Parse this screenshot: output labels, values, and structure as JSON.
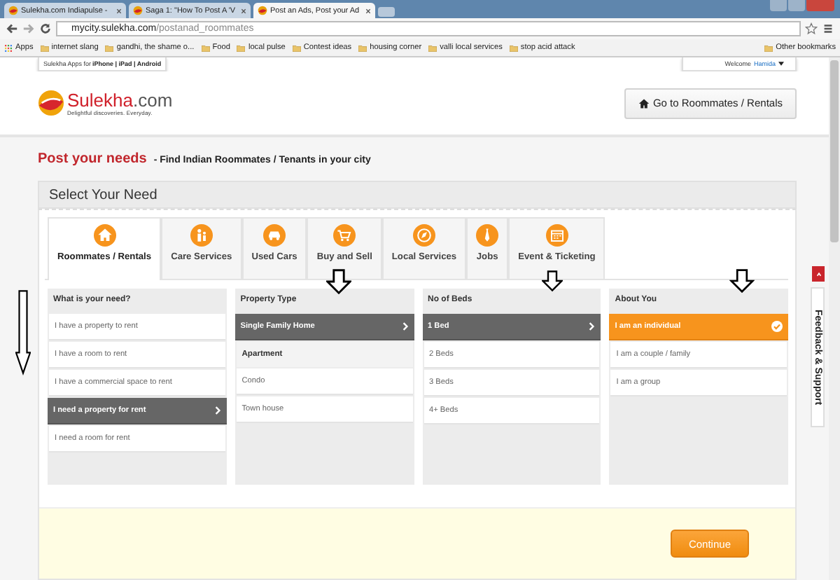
{
  "browser": {
    "tabs": [
      {
        "title": "Sulekha.com Indiapulse -",
        "selected": false
      },
      {
        "title": "Saga 1: \"How To Post A 'V",
        "selected": false
      },
      {
        "title": "Post an Ads, Post your Ad",
        "selected": true
      }
    ],
    "address": {
      "host": "mycity.sulekha.com",
      "path": "/postanad_roommates"
    },
    "bookmarks": [
      "Apps",
      "internet slang",
      "gandhi, the shame o...",
      "Food",
      "local pulse",
      "Contest ideas",
      "housing corner",
      "valli local services",
      "stop acid attack"
    ],
    "other_bookmarks": "Other bookmarks"
  },
  "top_bar": {
    "apps_prefix": "Sulekha Apps for",
    "apps_links": "iPhone | iPad | Android",
    "welcome": "Welcome",
    "user": "Hamida"
  },
  "logo": {
    "name": "Sulekha",
    "suffix": ".com",
    "tagline": "Delightful discoveries. Everyday."
  },
  "header_button": "Go to Roommates / Rentals",
  "heading": {
    "title": "Post your needs",
    "subtitle": "- Find Indian Roommates / Tenants in your city"
  },
  "section_title": "Select Your Need",
  "categories": [
    {
      "label": "Roommates / Rentals",
      "selected": true
    },
    {
      "label": "Care Services",
      "selected": false
    },
    {
      "label": "Used Cars",
      "selected": false
    },
    {
      "label": "Buy and Sell",
      "selected": false
    },
    {
      "label": "Local Services",
      "selected": false
    },
    {
      "label": "Jobs",
      "selected": false
    },
    {
      "label": "Event & Ticketing",
      "selected": false
    }
  ],
  "columns": [
    {
      "title": "What is your need?",
      "items": [
        {
          "kind": "option",
          "label": "I have a property to rent",
          "selected": false
        },
        {
          "kind": "option",
          "label": "I have a room to rent",
          "selected": false
        },
        {
          "kind": "option",
          "label": "I have a commercial space to rent",
          "selected": false
        },
        {
          "kind": "option",
          "label": "I need a property for rent",
          "selected": true
        },
        {
          "kind": "option",
          "label": "I need a room for rent",
          "selected": false
        }
      ]
    },
    {
      "title": "Property Type",
      "items": [
        {
          "kind": "option",
          "label": "Single Family Home",
          "selected": true
        },
        {
          "kind": "group",
          "label": "Apartment"
        },
        {
          "kind": "option",
          "label": "Condo",
          "selected": false
        },
        {
          "kind": "option",
          "label": "Town house",
          "selected": false
        }
      ]
    },
    {
      "title": "No of Beds",
      "items": [
        {
          "kind": "option",
          "label": "1 Bed",
          "selected": true
        },
        {
          "kind": "option",
          "label": "2 Beds",
          "selected": false
        },
        {
          "kind": "option",
          "label": "3 Beds",
          "selected": false
        },
        {
          "kind": "option",
          "label": "4+ Beds",
          "selected": false
        }
      ]
    },
    {
      "title": "About You",
      "kind": "check",
      "items": [
        {
          "kind": "option",
          "label": "I am an individual",
          "selected": true
        },
        {
          "kind": "option",
          "label": "I am a couple / family",
          "selected": false
        },
        {
          "kind": "option",
          "label": "I am a group",
          "selected": false
        }
      ]
    }
  ],
  "continue_button": "Continue",
  "feedback_tab": "Feedback & Support"
}
